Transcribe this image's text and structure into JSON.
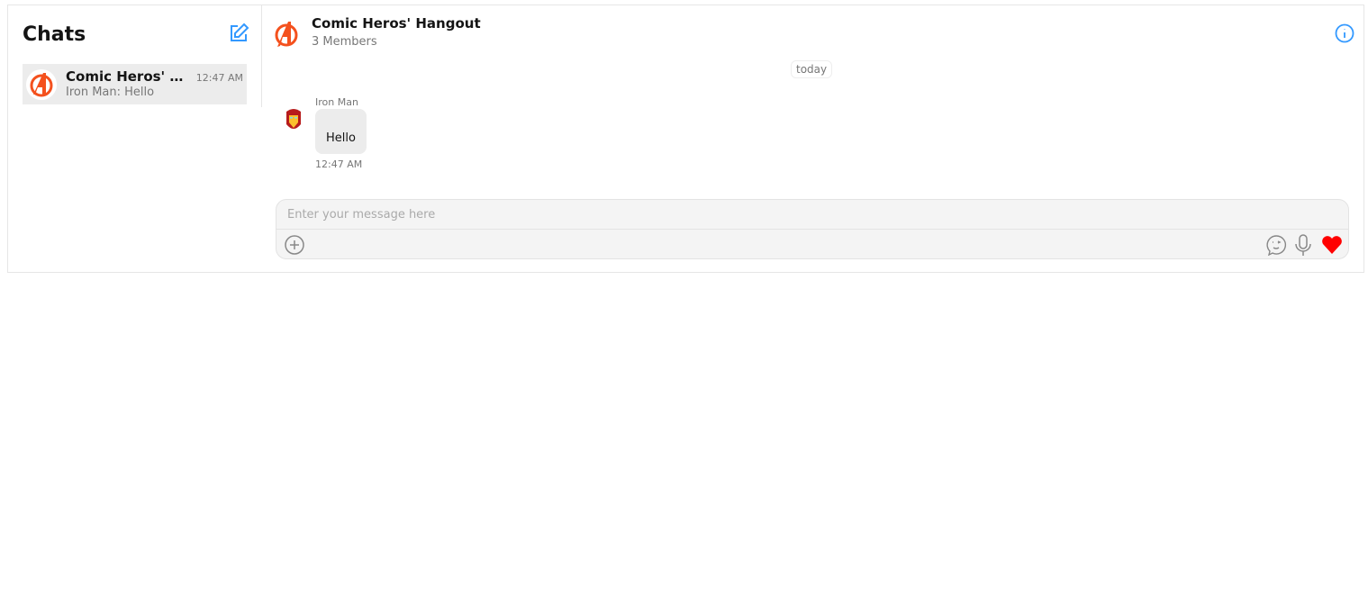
{
  "sidebar": {
    "title": "Chats",
    "chats": [
      {
        "name": "Comic Heros' Hangout",
        "time": "12:47 AM",
        "last_message": "Iron Man: Hello"
      }
    ]
  },
  "header": {
    "title": "Comic Heros' Hangout",
    "subtitle": "3 Members"
  },
  "messages": {
    "date_separator": "today",
    "items": [
      {
        "sender": "Iron Man",
        "text": "Hello",
        "time": "12:47 AM"
      }
    ]
  },
  "composer": {
    "placeholder": "Enter your message here"
  },
  "colors": {
    "accent": "#3399ff",
    "brand": "#f4511e",
    "heart": "#ff0000"
  }
}
